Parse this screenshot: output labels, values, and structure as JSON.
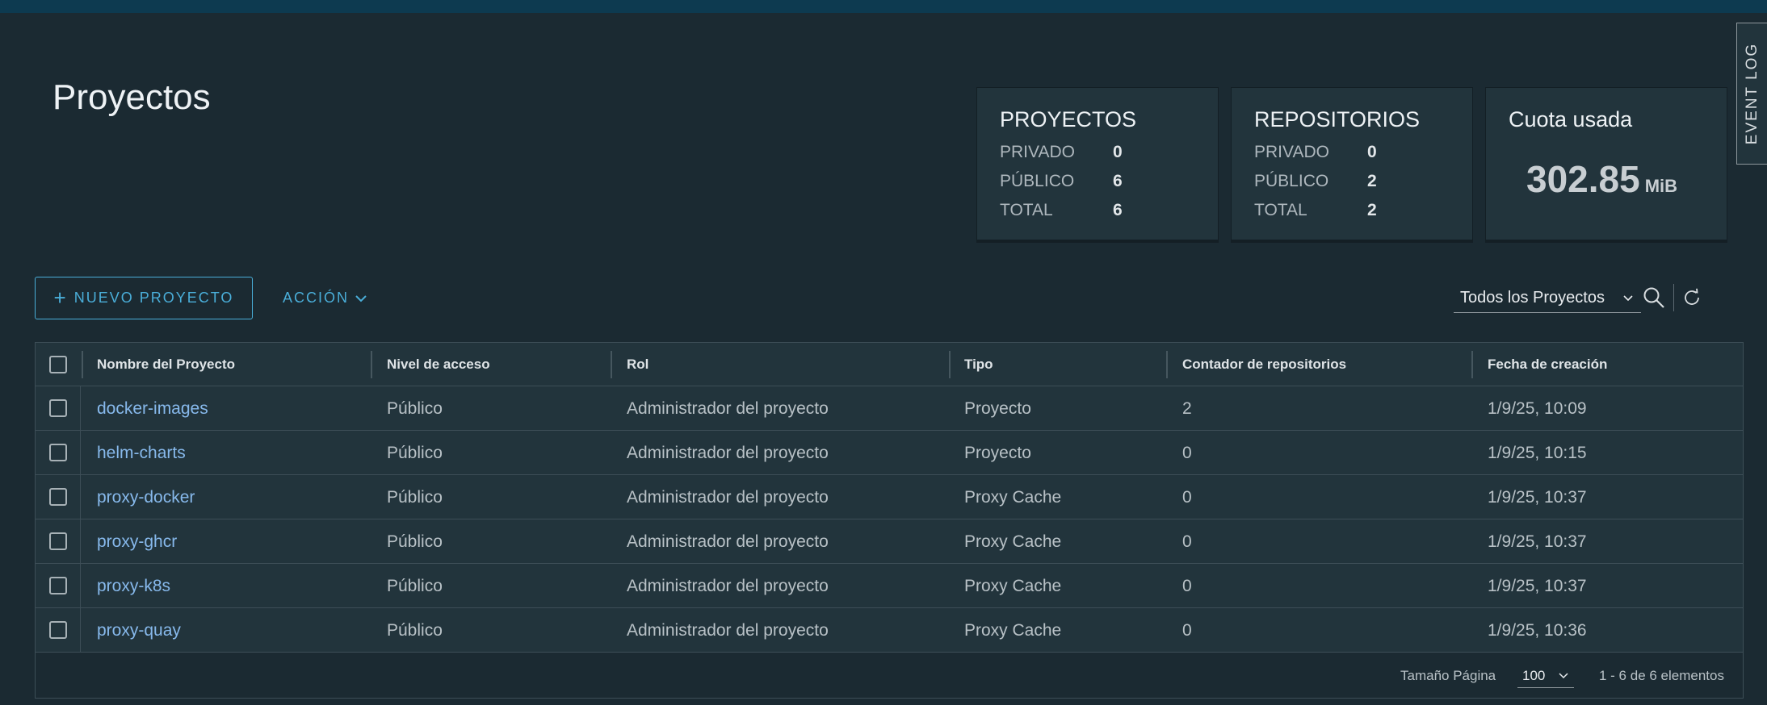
{
  "page": {
    "title": "Proyectos"
  },
  "cards": {
    "projects": {
      "title": "PROYECTOS",
      "rows": [
        {
          "label": "PRIVADO",
          "value": "0"
        },
        {
          "label": "PÚBLICO",
          "value": "6"
        },
        {
          "label": "TOTAL",
          "value": "6"
        }
      ]
    },
    "repositories": {
      "title": "REPOSITORIOS",
      "rows": [
        {
          "label": "PRIVADO",
          "value": "0"
        },
        {
          "label": "PÚBLICO",
          "value": "2"
        },
        {
          "label": "TOTAL",
          "value": "2"
        }
      ]
    },
    "quota": {
      "title": "Cuota usada",
      "value": "302.85",
      "unit": "MiB"
    }
  },
  "event_log": {
    "label": "EVENT LOG"
  },
  "toolbar": {
    "new_project": "NUEVO PROYECTO",
    "new_project_icon": "plus-icon",
    "action": "ACCIÓN",
    "action_icon": "chevron-down-icon",
    "filter_selected": "Todos los Proyectos",
    "search_icon": "search-icon",
    "refresh_icon": "refresh-icon"
  },
  "table": {
    "columns": [
      "Nombre del Proyecto",
      "Nivel de acceso",
      "Rol",
      "Tipo",
      "Contador de repositorios",
      "Fecha de creación"
    ],
    "rows": [
      {
        "name": "docker-images",
        "access": "Público",
        "role": "Administrador del proyecto",
        "type": "Proyecto",
        "repos": "2",
        "created": "1/9/25, 10:09"
      },
      {
        "name": "helm-charts",
        "access": "Público",
        "role": "Administrador del proyecto",
        "type": "Proyecto",
        "repos": "0",
        "created": "1/9/25, 10:15"
      },
      {
        "name": "proxy-docker",
        "access": "Público",
        "role": "Administrador del proyecto",
        "type": "Proxy Cache",
        "repos": "0",
        "created": "1/9/25, 10:37"
      },
      {
        "name": "proxy-ghcr",
        "access": "Público",
        "role": "Administrador del proyecto",
        "type": "Proxy Cache",
        "repos": "0",
        "created": "1/9/25, 10:37"
      },
      {
        "name": "proxy-k8s",
        "access": "Público",
        "role": "Administrador del proyecto",
        "type": "Proxy Cache",
        "repos": "0",
        "created": "1/9/25, 10:37"
      },
      {
        "name": "proxy-quay",
        "access": "Público",
        "role": "Administrador del proyecto",
        "type": "Proxy Cache",
        "repos": "0",
        "created": "1/9/25, 10:36"
      }
    ]
  },
  "pagination": {
    "page_size_label": "Tamaño Página",
    "page_size": "100",
    "count": "1 - 6 de 6 elementos"
  },
  "colors": {
    "background": "#1b2a32",
    "card": "#22343c",
    "accent": "#4aaed9",
    "link": "#87b9ec",
    "topbar": "#0d3a50"
  }
}
